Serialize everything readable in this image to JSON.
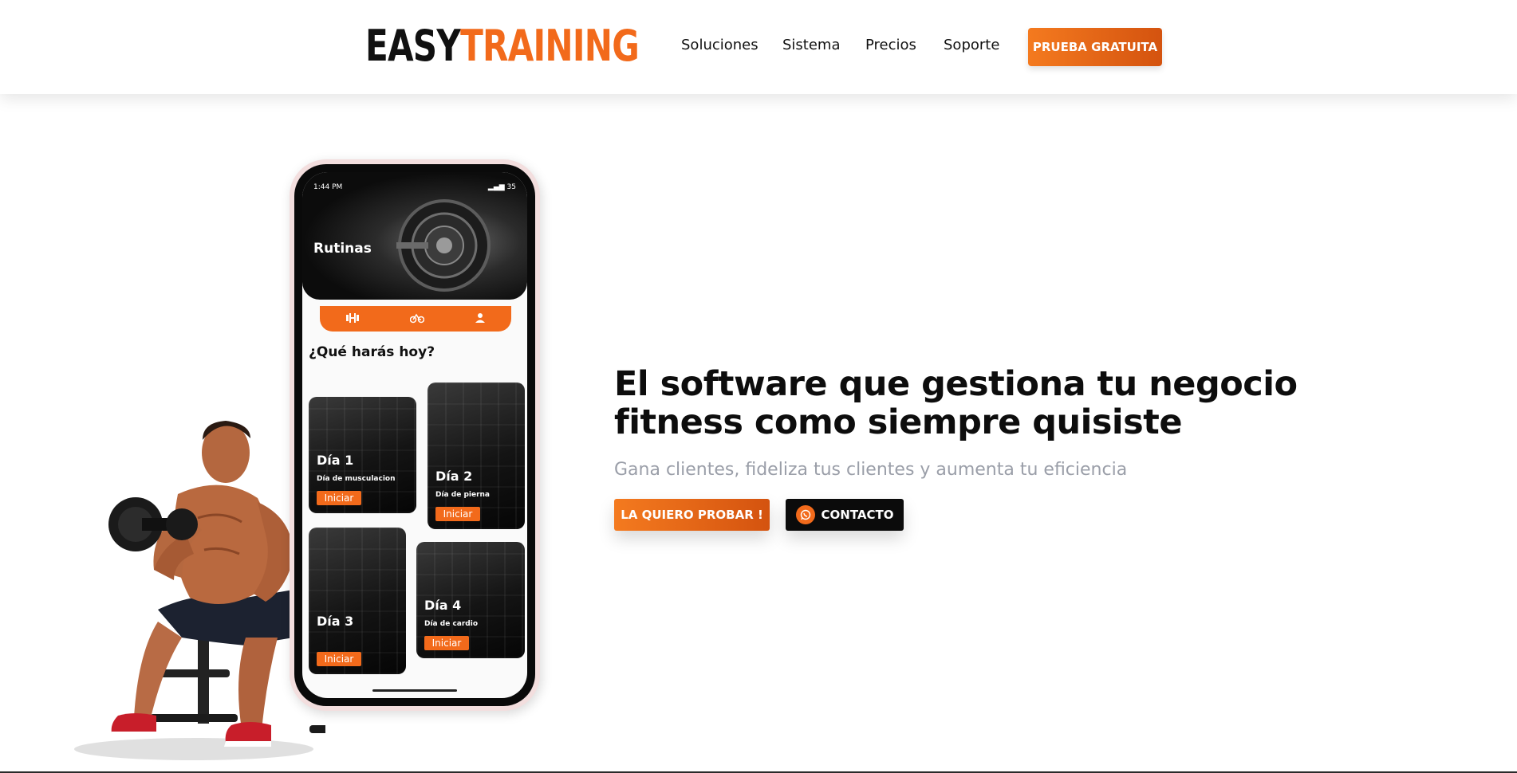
{
  "header": {
    "logo": {
      "part1": "EASY",
      "part2": "TRAINING"
    },
    "nav": [
      {
        "label": "Soluciones"
      },
      {
        "label": "Sistema"
      },
      {
        "label": "Precios"
      },
      {
        "label": "Soporte"
      }
    ],
    "cta": "PRUEBA GRATUITA"
  },
  "hero": {
    "title": "El software que gestiona tu negocio fitness como siempre quisiste",
    "subtitle": "Gana clientes, fideliza tus clientes y aumenta tu eficiencia",
    "primary_button": "LA QUIERO PROBAR !",
    "secondary_button": "CONTACTO"
  },
  "phone": {
    "status_time": "1:44 PM",
    "battery": "35",
    "screen_title": "Rutinas",
    "tabs": [
      "dumbbell-icon",
      "bike-icon",
      "person-icon"
    ],
    "section_title": "¿Qué harás hoy?",
    "cards": [
      {
        "day": "Día 1",
        "desc": "Día de musculacion",
        "button": "Iniciar"
      },
      {
        "day": "Día 2",
        "desc": "Día de pierna",
        "button": "Iniciar"
      },
      {
        "day": "Día 3",
        "desc": "",
        "button": "Iniciar"
      },
      {
        "day": "Día 4",
        "desc": "Día de cardio",
        "button": "Iniciar"
      }
    ]
  },
  "colors": {
    "accent": "#f26a1b",
    "accent_dark": "#d4530f",
    "dark": "#0b0b0b",
    "subtitle": "#9a9ea8"
  }
}
